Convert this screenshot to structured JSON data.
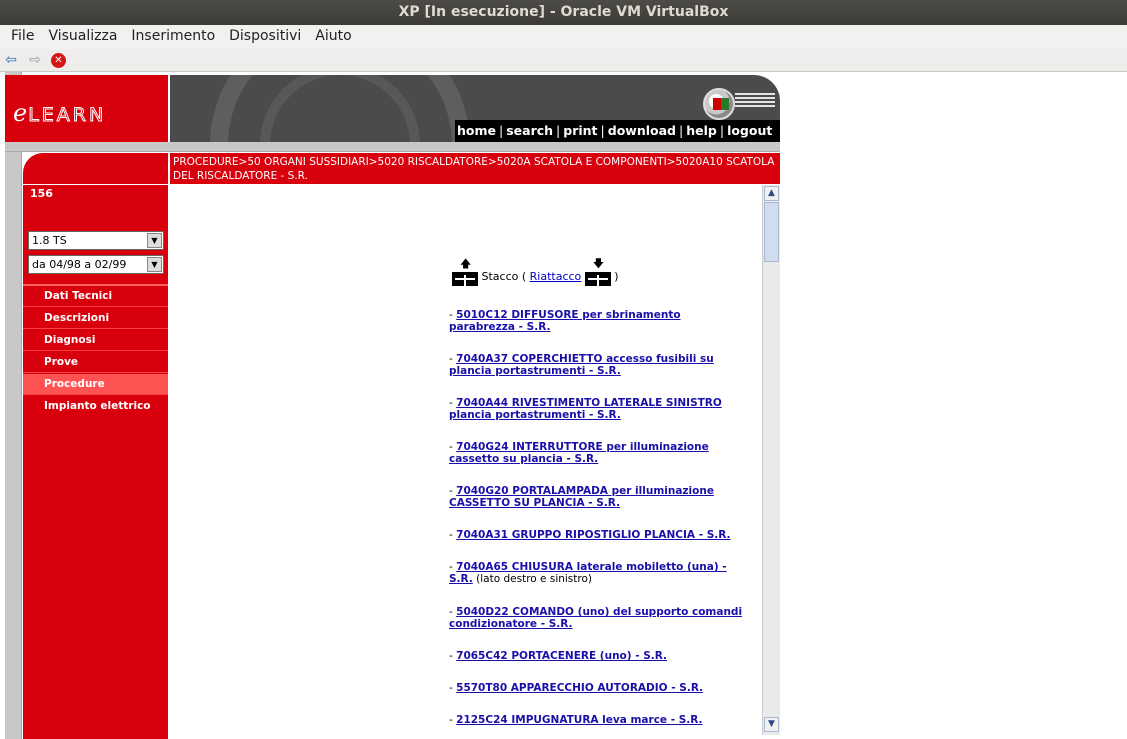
{
  "window": {
    "title": "XP [In esecuzione] - Oracle VM VirtualBox"
  },
  "menubar": [
    "File",
    "Visualizza",
    "Inserimento",
    "Dispositivi",
    "Aiuto"
  ],
  "toolbar": {
    "back_icon": "back-arrow-icon",
    "forward_icon": "forward-arrow-icon",
    "stop_icon": "stop-icon"
  },
  "header": {
    "logo": "eLEARN",
    "nav": [
      "home",
      "search",
      "print",
      "download",
      "help",
      "logout"
    ]
  },
  "breadcrumb": "PROCEDURE>50 ORGANI SUSSIDIARI>5020 RISCALDATORE>5020A SCATOLA E COMPONENTI>5020A10 SCATOLA DEL RISCALDATORE - S.R.",
  "sidebar": {
    "code": "156",
    "model_select": "1.8 TS",
    "range_select": "da 04/98 a 02/99",
    "menu": [
      {
        "label": "Dati Tecnici",
        "active": false
      },
      {
        "label": "Descrizioni",
        "active": false
      },
      {
        "label": "Diagnosi",
        "active": false
      },
      {
        "label": "Prove",
        "active": false
      },
      {
        "label": "Procedure",
        "active": true
      },
      {
        "label": "Impianto elettrico",
        "active": false
      }
    ]
  },
  "content": {
    "stacco": "Stacco (",
    "riattacco": "Riattacco",
    "close_paren": ")",
    "procedures": [
      {
        "link": "5010C12  DIFFUSORE per sbrinamento parabrezza - S.R.",
        "note": ""
      },
      {
        "link": "7040A37  COPERCHIETTO accesso fusibili su plancia portastrumenti - S.R.",
        "note": ""
      },
      {
        "link": "7040A44  RIVESTIMENTO LATERALE SINISTRO plancia portastrumenti - S.R.",
        "note": ""
      },
      {
        "link": "7040G24  INTERRUTTORE per illuminazione cassetto su plancia - S.R.",
        "note": ""
      },
      {
        "link": "7040G20  PORTALAMPADA per illuminazione CASSETTO SU PLANCIA - S.R.",
        "note": ""
      },
      {
        "link": "7040A31  GRUPPO RIPOSTIGLIO PLANCIA - S.R.",
        "note": ""
      },
      {
        "link": "7040A65  CHIUSURA laterale mobiletto (una) - S.R.",
        "note": " (lato destro e sinistro)"
      },
      {
        "link": "5040D22  COMANDO (uno) del supporto comandi condizionatore - S.R.",
        "note": ""
      },
      {
        "link": "7065C42  PORTACENERE (uno) - S.R.",
        "note": ""
      },
      {
        "link": "5570T80  APPARECCHIO AUTORADIO - S.R.",
        "note": ""
      },
      {
        "link": "2125C24  IMPUGNATURA leva marce - S.R.",
        "note": ""
      }
    ]
  }
}
